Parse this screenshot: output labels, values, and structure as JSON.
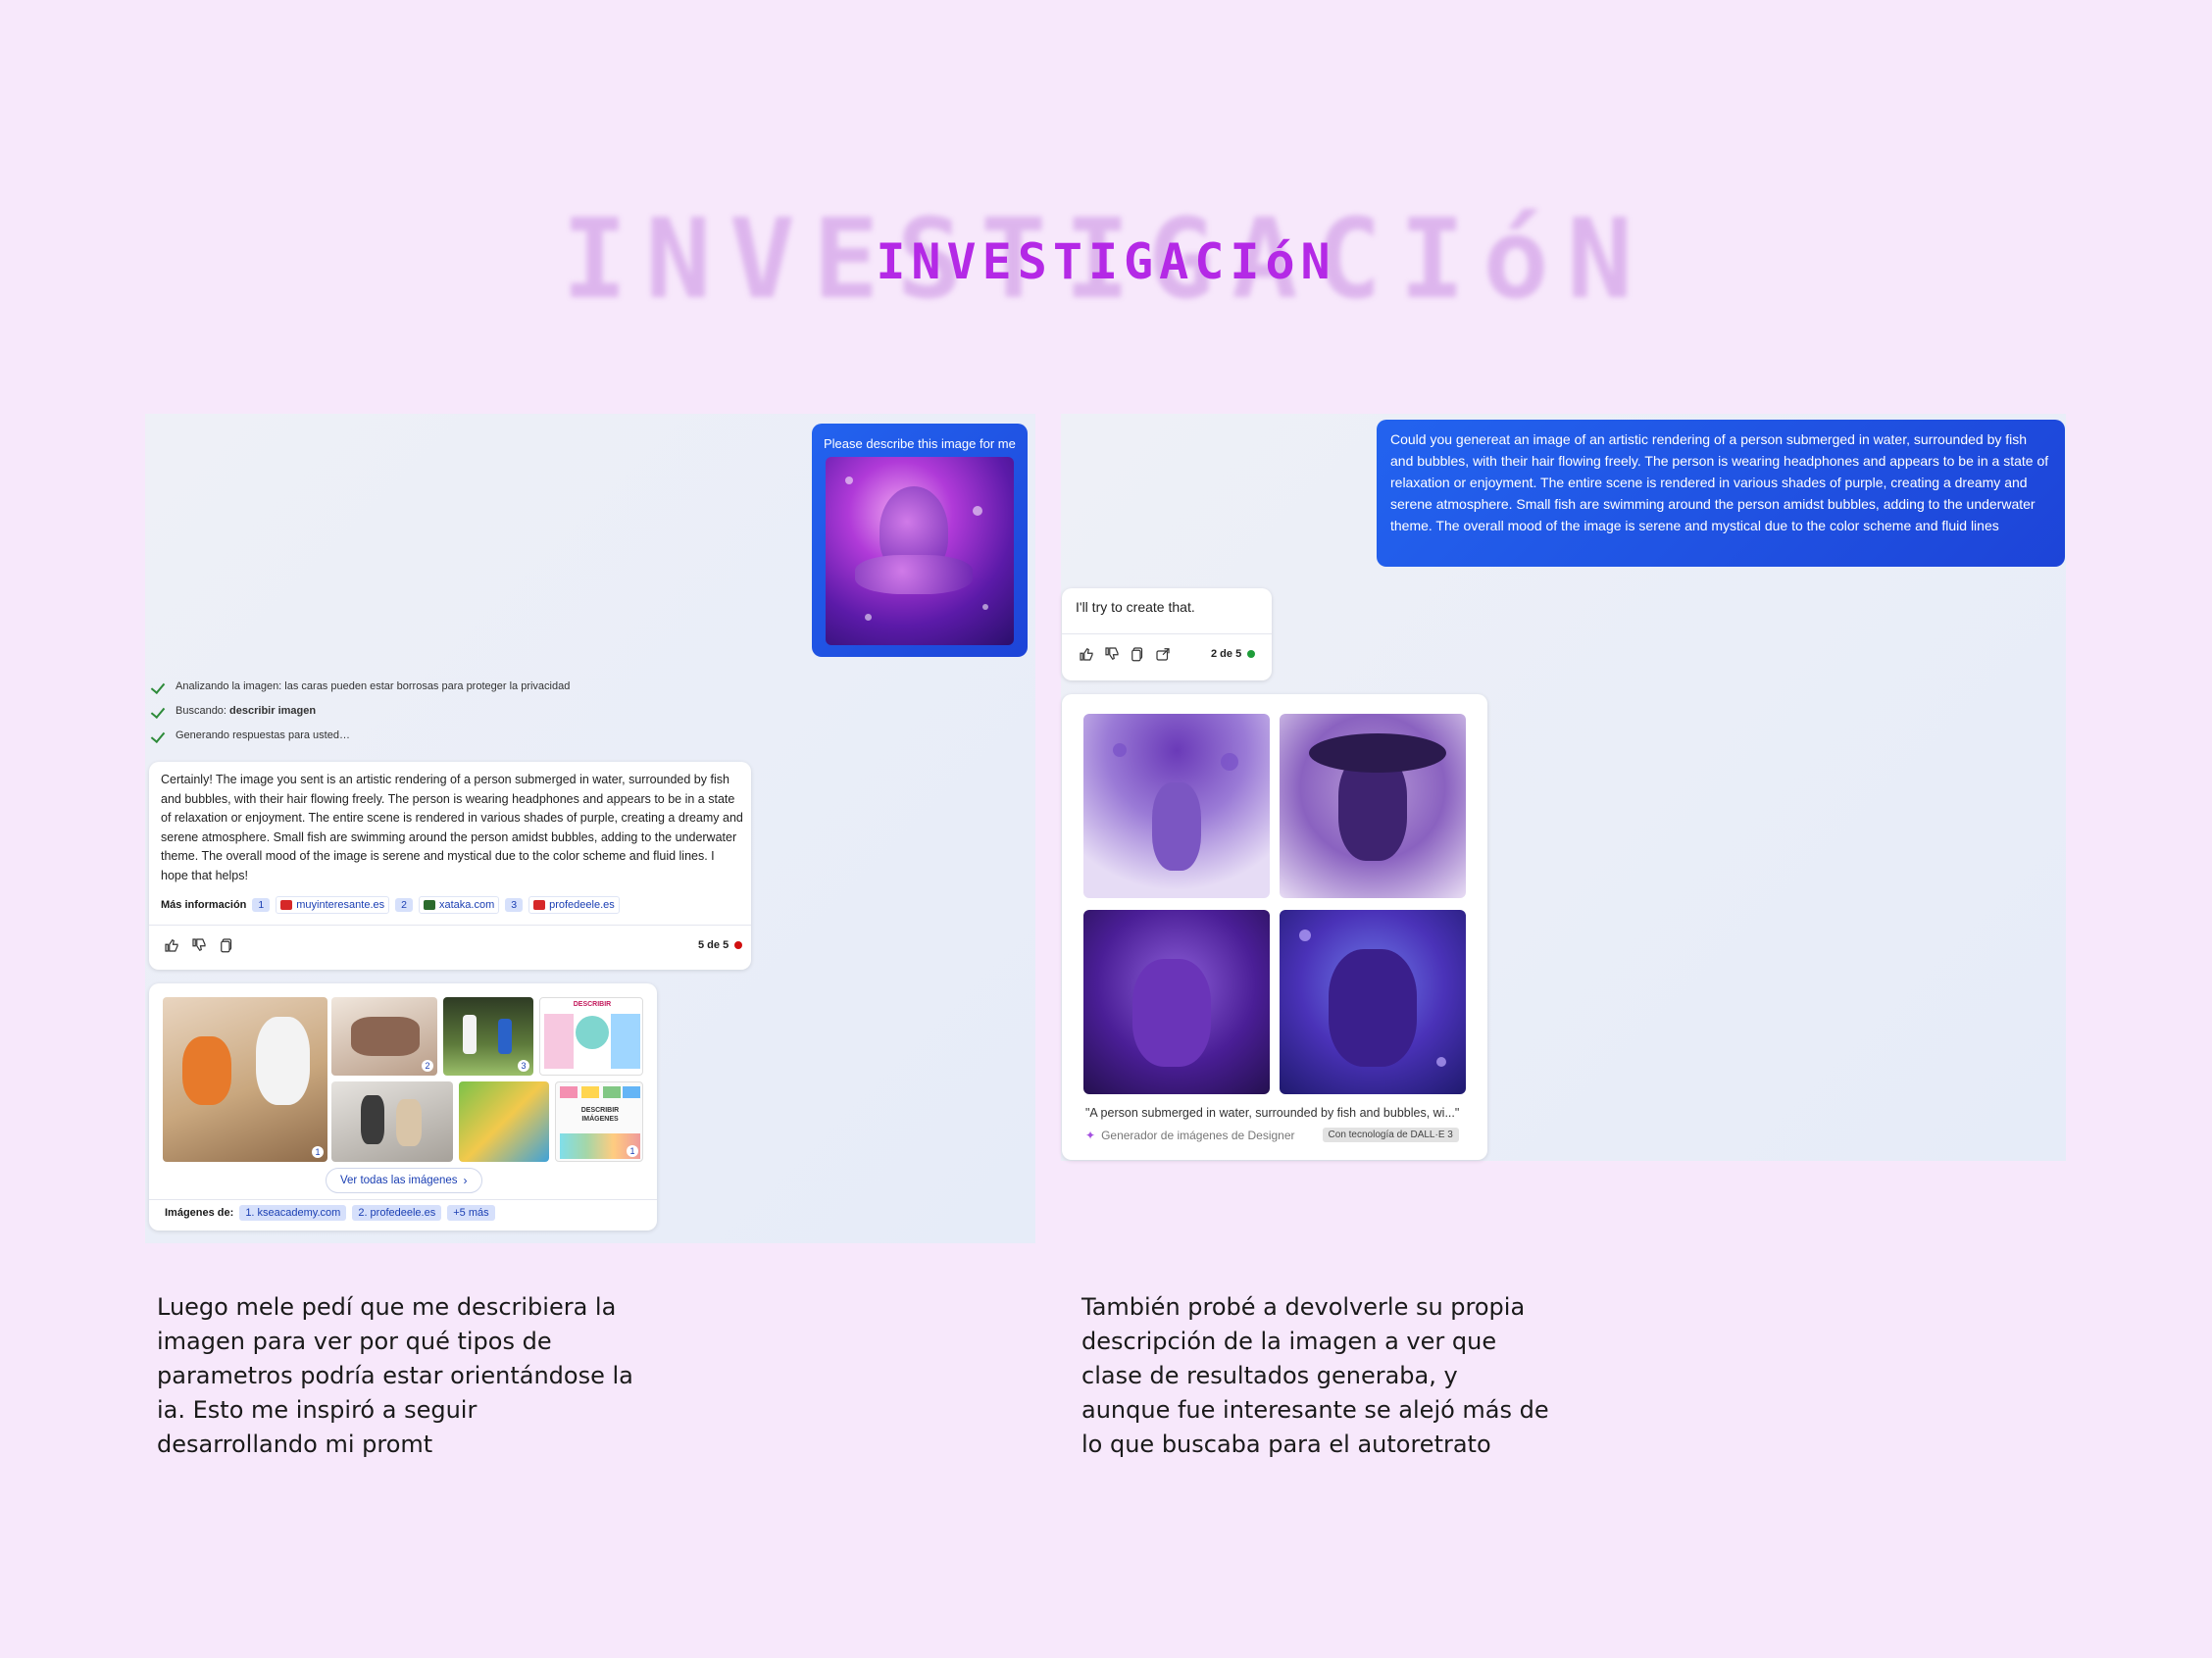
{
  "title": "INVESTIGACIóN",
  "left": {
    "user_prompt": "Please describe this image for me",
    "status": [
      {
        "text": "Analizando la imagen: las caras pueden estar borrosas para proteger la privacidad",
        "bold": ""
      },
      {
        "text": "Buscando: ",
        "bold": "describir imagen"
      },
      {
        "text": "Generando respuestas para usted…",
        "bold": ""
      }
    ],
    "response": "Certainly! The image you sent is an artistic rendering of a person submerged in water, surrounded by fish and bubbles, with their hair flowing freely. The person is wearing headphones and appears to be in a state of relaxation or enjoyment. The entire scene is rendered in various shades of purple, creating a dreamy and serene atmosphere. Small fish are swimming around the person amidst bubbles, adding to the underwater theme. The overall mood of the image is serene and mystical due to the color scheme and fluid lines. I hope that helps!",
    "more_label": "Más información",
    "sources": [
      {
        "num": "1",
        "name": "muyinteresante.es",
        "color": "#d62828"
      },
      {
        "num": "2",
        "name": "xataka.com",
        "color": "#2b6b2b"
      },
      {
        "num": "3",
        "name": "profedeele.es",
        "color": "#d62828"
      }
    ],
    "counter": "5 de 5",
    "counter_color": "#d10f0f",
    "see_all": "Ver todas las imágenes",
    "images_from_label": "Imágenes de:",
    "image_sources": [
      "1. kseacademy.com",
      "2. profedeele.es",
      "+5 más"
    ],
    "thumb_badges": [
      "1",
      "2",
      "3",
      "1"
    ],
    "thumb_overlay_texts": [
      "DESCRIBIR",
      "IMÁGENES",
      "DESCRIBIR",
      "IMÁGENES"
    ],
    "caption": "Luego mele pedí que me describiera la imagen para ver por qué tipos de parametros podría estar orientándose la ia. Esto me inspiró a seguir desarrollando mi promt"
  },
  "right": {
    "user_prompt": "Could you genereat an image of an artistic rendering of a person submerged in water, surrounded by fish and bubbles, with their hair flowing freely. The person is wearing headphones and appears to be in a state of relaxation or enjoyment. The entire scene is rendered in various shades of purple, creating a dreamy and serene atmosphere. Small fish are swimming around the person amidst bubbles, adding to the underwater theme. The overall mood of the image is serene and mystical due to the color scheme and fluid lines",
    "reply": "I'll try to create that.",
    "counter": "2 de 5",
    "counter_color": "#1f9d3a",
    "gen_caption": "\"A person submerged in water, surrounded by fish and bubbles, wi...\"",
    "generator": "Generador de imágenes de Designer",
    "powered": "Con tecnología de DALL·E 3",
    "caption": "También probé a devolverle su propia descripción de la imagen a ver que clase de resultados generaba, y aunque fue interesante se alejó más de lo que buscaba para el autoretrato"
  }
}
